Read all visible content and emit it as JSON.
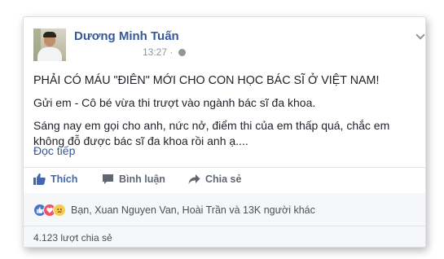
{
  "post": {
    "author": "Dương Minh Tuấn",
    "time": "13:27",
    "separator": "·",
    "lines": [
      "PHẢI CÓ MÁU \"ĐIÊN\" MỚI CHO CON HỌC BÁC SĨ Ở VIỆT NAM!",
      "Gửi em - Cô bé vừa thi trượt vào ngành bác sĩ đa khoa.",
      "Sáng nay em gọi cho anh, nức nở, điểm thi của em thấp quá, chắc em không đỗ được bác sĩ đa khoa rồi anh ạ...."
    ],
    "see_more": "Đọc tiếp"
  },
  "actions": {
    "like": "Thích",
    "comment": "Bình luận",
    "share": "Chia sẻ"
  },
  "reactions": {
    "icons": [
      "like-reaction-icon",
      "love-reaction-icon",
      "sad-reaction-icon"
    ],
    "names": "Bạn, Xuan Nguyen Van, Hoài Trần và 13K người khác"
  },
  "shares": "4.123 lượt chia sẻ",
  "colors": {
    "link": "#365899",
    "like_blue": "#4267b2",
    "text": "#1d2129",
    "muted": "#90949c"
  }
}
